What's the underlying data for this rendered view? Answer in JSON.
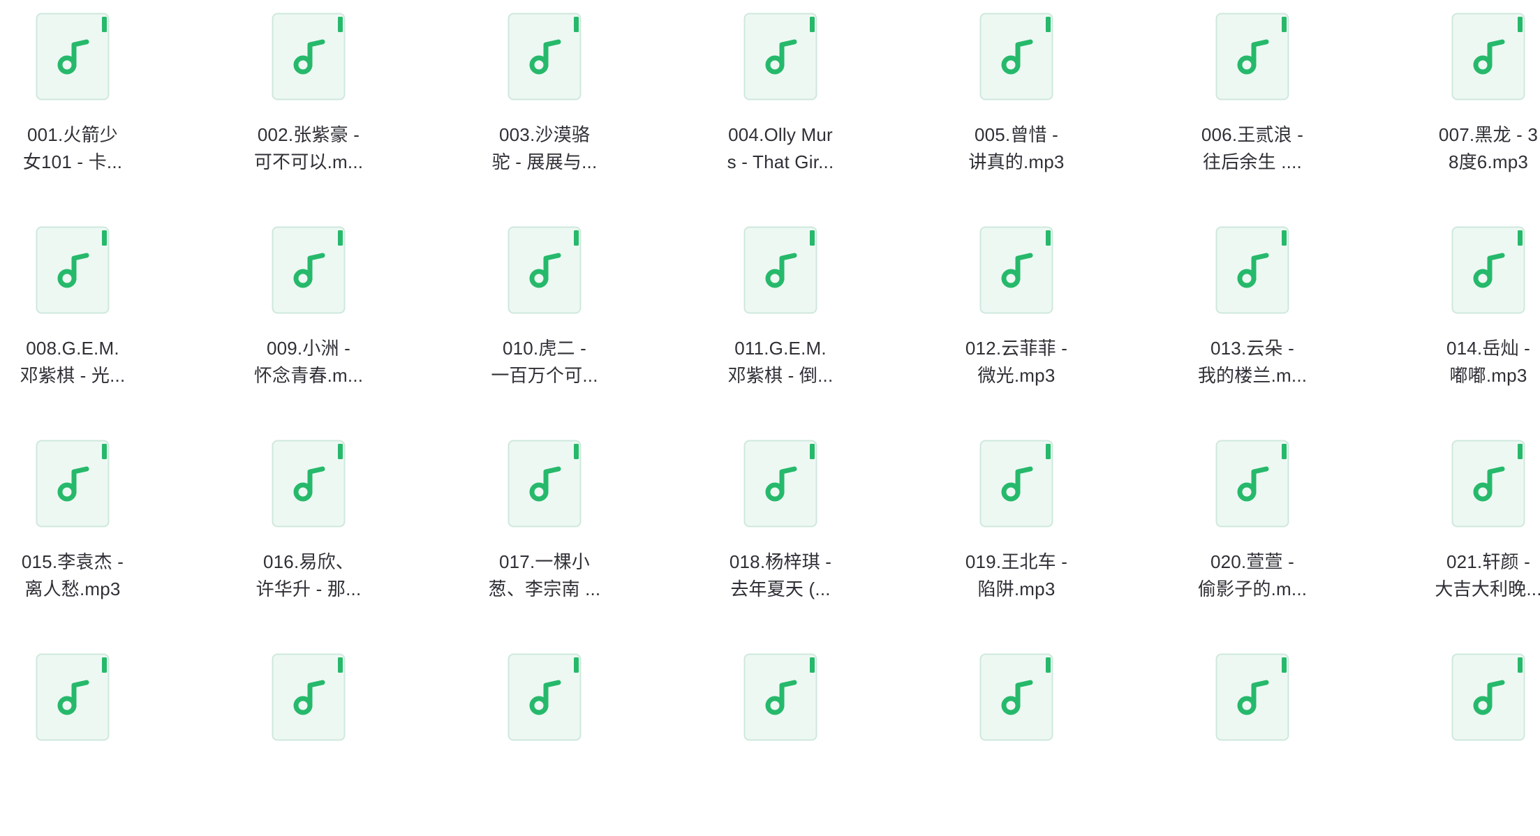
{
  "view": {
    "type": "icon-grid",
    "file_icon": "music-file-icon",
    "accent_color": "#26b96b",
    "icon_background": "#edf8f3",
    "icon_border": "#cfe8dc"
  },
  "files": [
    {
      "line1": "001.火箭少",
      "line2": "女101 - 卡..."
    },
    {
      "line1": "002.张紫豪 -",
      "line2": "可不可以.m..."
    },
    {
      "line1": "003.沙漠骆",
      "line2": "驼 - 展展与..."
    },
    {
      "line1": "004.Olly Mur",
      "line2": "s - That Gir..."
    },
    {
      "line1": "005.曾惜 -",
      "line2": "讲真的.mp3"
    },
    {
      "line1": "006.王贰浪 -",
      "line2": "往后余生 ...."
    },
    {
      "line1": "007.黑龙 - 3",
      "line2": "8度6.mp3"
    },
    {
      "line1": "008.G.E.M.",
      "line2": "邓紫棋 - 光..."
    },
    {
      "line1": "009.小洲 -",
      "line2": "怀念青春.m..."
    },
    {
      "line1": "010.虎二 -",
      "line2": "一百万个可..."
    },
    {
      "line1": "011.G.E.M.",
      "line2": "邓紫棋 - 倒..."
    },
    {
      "line1": "012.云菲菲 -",
      "line2": "微光.mp3"
    },
    {
      "line1": "013.云朵 -",
      "line2": "我的楼兰.m..."
    },
    {
      "line1": "014.岳灿 -",
      "line2": "嘟嘟.mp3"
    },
    {
      "line1": "015.李袁杰 -",
      "line2": "离人愁.mp3"
    },
    {
      "line1": "016.易欣、",
      "line2": "许华升 - 那..."
    },
    {
      "line1": "017.一棵小",
      "line2": "葱、李宗南 ..."
    },
    {
      "line1": "018.杨梓琪 -",
      "line2": "去年夏天 (..."
    },
    {
      "line1": "019.王北车 -",
      "line2": "陷阱.mp3"
    },
    {
      "line1": "020.萱萱 -",
      "line2": "偷影子的.m..."
    },
    {
      "line1": "021.轩颜 -",
      "line2": "大吉大利晚..."
    },
    {
      "line1": "",
      "line2": ""
    },
    {
      "line1": "",
      "line2": ""
    },
    {
      "line1": "",
      "line2": ""
    },
    {
      "line1": "",
      "line2": ""
    },
    {
      "line1": "",
      "line2": ""
    },
    {
      "line1": "",
      "line2": ""
    },
    {
      "line1": "",
      "line2": ""
    }
  ]
}
